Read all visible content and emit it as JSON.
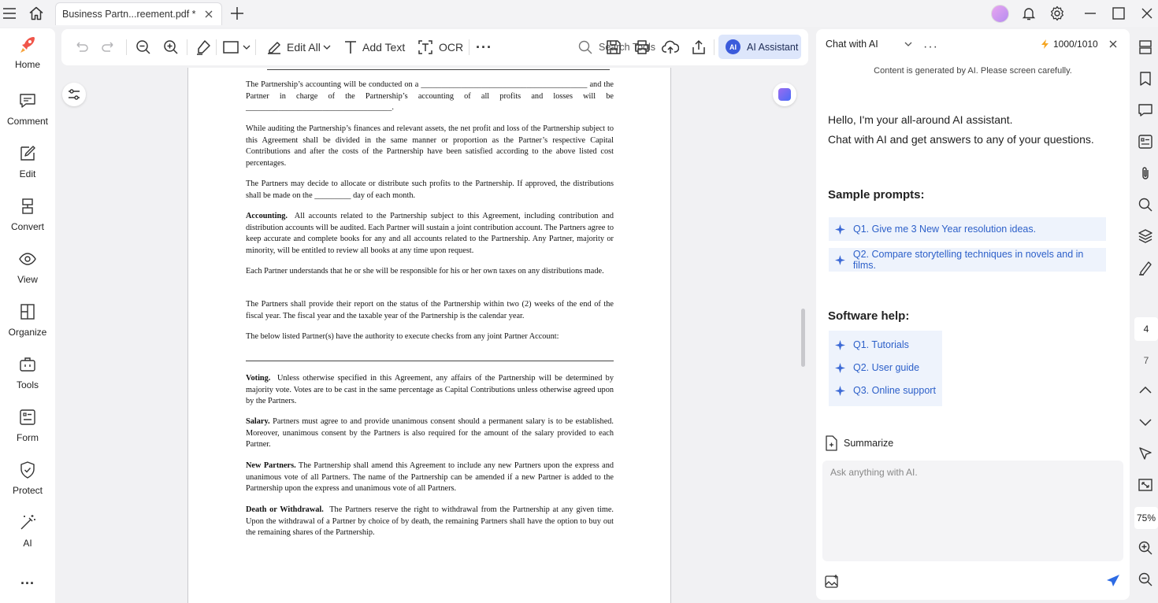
{
  "titlebar": {
    "tab_title": "Business Partn...reement.pdf *"
  },
  "sidebar": {
    "items": [
      {
        "label": "Home",
        "icon": "rocket-icon"
      },
      {
        "label": "Comment",
        "icon": "comment-icon"
      },
      {
        "label": "Edit",
        "icon": "edit-icon"
      },
      {
        "label": "Convert",
        "icon": "convert-icon"
      },
      {
        "label": "View",
        "icon": "eye-icon"
      },
      {
        "label": "Organize",
        "icon": "organize-icon"
      },
      {
        "label": "Tools",
        "icon": "toolbox-icon"
      },
      {
        "label": "Form",
        "icon": "form-icon"
      },
      {
        "label": "Protect",
        "icon": "shield-icon"
      },
      {
        "label": "AI",
        "icon": "magic-wand-icon"
      }
    ],
    "more": "..."
  },
  "toolbar": {
    "edit_all": "Edit All",
    "add_text": "Add Text",
    "ocr": "OCR",
    "search_tools": "Search Tools",
    "ai_badge": "AI",
    "ai_assistant": "AI Assistant"
  },
  "document": {
    "p1": "The Partnership’s accounting will be conducted on a _________________________________________ and the Partner in charge of the Partnership’s accounting of all profits and losses will be ____________________________________.",
    "p2": "While auditing the Partnership’s finances and relevant assets, the net profit and loss of the Partnership subject to this Agreement shall be divided in the same manner or proportion as the Partner’s respective Capital Contributions and after the costs of the Partnership have been satisfied according to the above listed cost percentages.",
    "p3": "The Partners may decide to allocate or distribute such profits to the Partnership. If approved, the distributions shall be made on the _________ day of each month.",
    "p4_head": "Accounting.",
    "p4": "All accounts related to the Partnership subject to this Agreement, including contribution and distribution accounts will be audited. Each Partner will sustain a joint contribution account. The Partners agree to keep accurate and complete books for any and all accounts related to the Partnership. Any Partner, majority or minority, will be entitled to review all books at any time upon request.",
    "p5": "Each Partner understands that he or she will be responsible for his or her own taxes on any distributions made.",
    "p6": "The Partners shall provide their report on the status of the Partnership within two (2) weeks of the end of the fiscal year. The fiscal year and the taxable year of the Partnership is the calendar year.",
    "p7": "The below listed Partner(s) have the authority to execute checks from any joint Partner Account:",
    "p8_head": "Voting.",
    "p8": "Unless otherwise specified in this Agreement, any affairs of the Partnership will be determined by majority vote. Votes are to be cast in the same percentage as Capital Contributions unless otherwise agreed upon by the Partners.",
    "p9_head": "Salary.",
    "p9": "Partners must agree to and provide unanimous consent should a permanent salary is to be established. Moreover, unanimous consent by the Partners is also required for the amount of the salary provided to each Partner.",
    "p10_head": "New Partners.",
    "p10": "The Partnership shall amend this Agreement to include any new Partners upon the express and unanimous vote of all Partners. The name of the Partnership can be amended if a new Partner is added to the Partnership upon the express and unanimous vote of all Partners.",
    "p11_head": "Death or Withdrawal.",
    "p11": "The Partners reserve the right to withdrawal from the Partnership at any given time. Upon the withdrawal of a Partner by choice of by death, the remaining Partners shall have the option to buy out the remaining shares of the Partnership."
  },
  "chat": {
    "mode": "Chat with AI",
    "credits": "1000/1010",
    "disclaimer": "Content is generated by AI. Please screen carefully.",
    "greeting_1": "Hello, I'm your all-around AI assistant.",
    "greeting_2": "Chat with AI and get answers to any of your questions.",
    "sample_title": "Sample prompts:",
    "samples": [
      "Q1. Give me 3 New Year resolution ideas.",
      "Q2. Compare storytelling techniques in novels and in films."
    ],
    "help_title": "Software help:",
    "help": [
      "Q1. Tutorials",
      "Q2. User guide",
      "Q3. Online support"
    ],
    "summarize": "Summarize",
    "input_placeholder": "Ask anything with AI."
  },
  "rail": {
    "page_current": "4",
    "page_total": "7",
    "zoom": "75%"
  }
}
